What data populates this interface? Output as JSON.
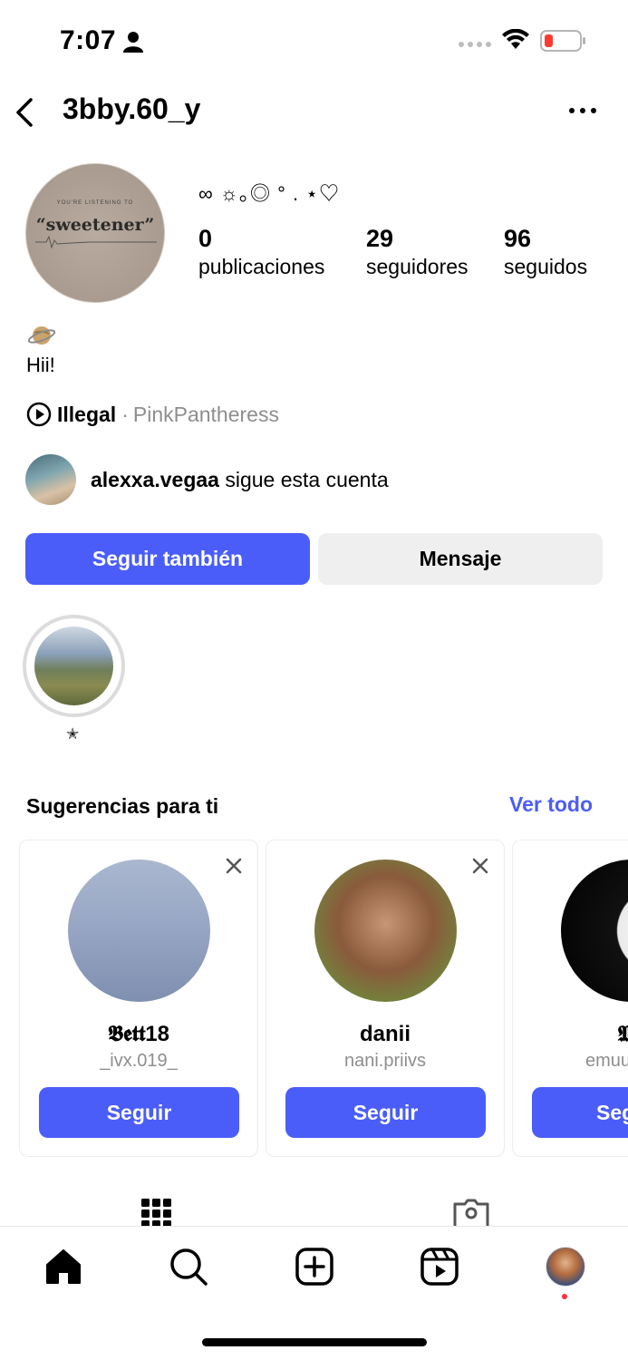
{
  "status_bar": {
    "time": "7:07",
    "icons": [
      "person-icon",
      "signal-dots",
      "wifi-icon",
      "battery-low-icon"
    ]
  },
  "header": {
    "username": "3bby.60_y",
    "back_icon": "back-chevron-icon",
    "more_icon": "more-horizontal-icon"
  },
  "profile": {
    "avatar": {
      "small_text": "YOU'RE LISTENING TO",
      "title": "“sweetener”"
    },
    "display_name": "∞ ☼｡◎ ° . ⋆♡",
    "stats": [
      {
        "value": "0",
        "label": "publicaciones"
      },
      {
        "value": "29",
        "label": "seguidores"
      },
      {
        "value": "96",
        "label": "seguidos"
      }
    ],
    "bio_emoji": "planet-icon",
    "bio_text": "Hii!",
    "music": {
      "song": "Illegal",
      "separator": "·",
      "artist": "PinkPantheress"
    },
    "followed_by": {
      "username": "alexxa.vegaa",
      "text": " sigue esta cuenta"
    },
    "buttons": {
      "follow_back": "Seguir también",
      "message": "Mensaje"
    },
    "highlights": [
      {
        "label": "✭"
      }
    ]
  },
  "suggestions": {
    "title": "Sugerencias para ti",
    "see_all": "Ver todo",
    "cards": [
      {
        "name": "𝕭𝖊𝖙𝖙18",
        "handle": "_ivx.019_",
        "button": "Seguir"
      },
      {
        "name": "danii",
        "handle": "nani.priivs",
        "button": "Seguir"
      },
      {
        "name": "𝕸",
        "handle": "emuu",
        "button": "Seguir"
      }
    ]
  },
  "tabs": [
    "grid-icon",
    "tagged-icon"
  ],
  "bottom_nav": [
    "home-icon",
    "search-icon",
    "create-icon",
    "reels-icon",
    "profile-avatar"
  ],
  "colors": {
    "accent": "#4a5df9",
    "secondary_button": "#efeff0",
    "muted_text": "#8e8e8e",
    "notification_dot": "#ff3040"
  }
}
